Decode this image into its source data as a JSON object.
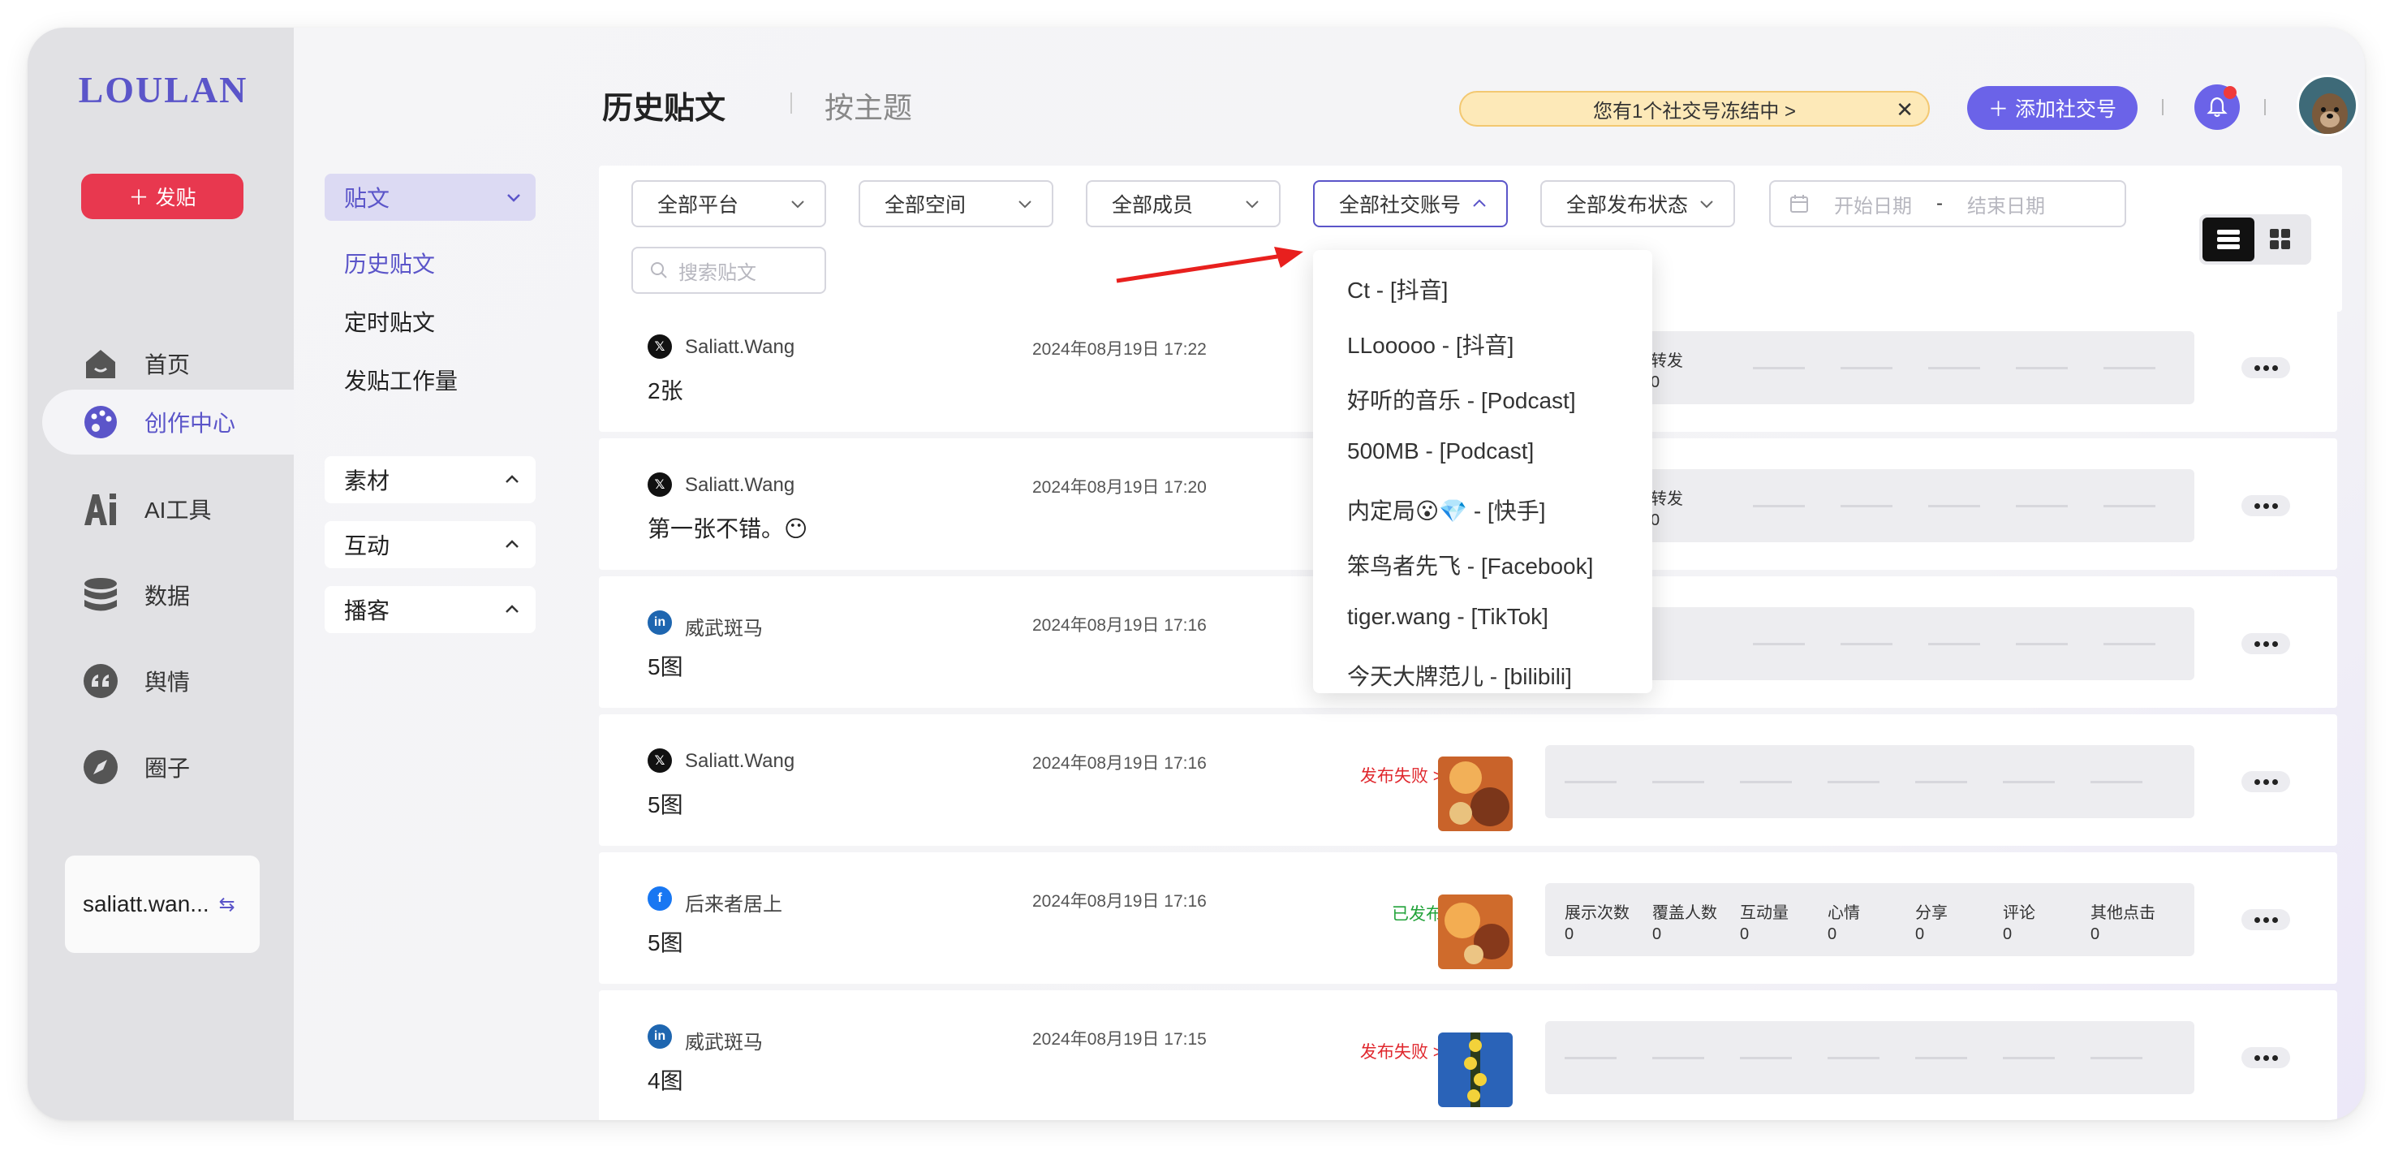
{
  "app": {
    "logo": "LOULAN"
  },
  "sidebar": {
    "post_button": "发贴",
    "items": [
      {
        "label": "首页",
        "icon": "home-icon"
      },
      {
        "label": "创作中心",
        "icon": "palette-icon",
        "active": true
      },
      {
        "label": "AI工具",
        "icon": "ai-icon"
      },
      {
        "label": "数据",
        "icon": "database-icon"
      },
      {
        "label": "舆情",
        "icon": "quote-icon"
      },
      {
        "label": "圈子",
        "icon": "compass-icon"
      }
    ],
    "user": {
      "name": "saliatt.wan...",
      "icon": "switch-account-icon"
    }
  },
  "subnav": {
    "header": "贴文",
    "links": [
      "历史贴文",
      "定时贴文",
      "发贴工作量"
    ],
    "groups": [
      "素材",
      "互动",
      "播客"
    ]
  },
  "header": {
    "title": "历史贴文",
    "tab2": "按主题",
    "notice": "您有1个社交号冻结中 >",
    "add_social": "添加社交号"
  },
  "filters": {
    "platform": "全部平台",
    "space": "全部空间",
    "member": "全部成员",
    "account": "全部社交账号",
    "status": "全部发布状态",
    "start_date": "开始日期",
    "date_sep": "-",
    "end_date": "结束日期",
    "search_placeholder": "搜索贴文"
  },
  "dropdown": {
    "options": [
      "Ct - [抖音]",
      "LLooooo - [抖音]",
      "好听的音乐 - [Podcast]",
      "500MB - [Podcast]",
      "内定局😮💎 - [快手]",
      "笨鸟者先飞 - [Facebook]",
      "tiger.wang - [TikTok]",
      "今天大牌范儿 - [bilibili]"
    ]
  },
  "stats_labels": [
    "展示次数",
    "覆盖人数",
    "互动量",
    "心情",
    "分享",
    "评论",
    "其他点击"
  ],
  "posts": [
    {
      "platform": "x",
      "author": "Saliatt.Wang",
      "content": "2张",
      "time": "2024年08月19日 17:22",
      "stat_label": "转发",
      "stat_value": "0"
    },
    {
      "platform": "x",
      "author": "Saliatt.Wang",
      "content": "第一张不错。😶",
      "time": "2024年08月19日 17:20",
      "stat_label": "转发",
      "stat_value": "0"
    },
    {
      "platform": "linkedin",
      "author": "威武斑马",
      "content": "5图",
      "time": "2024年08月19日 17:16"
    },
    {
      "platform": "x",
      "author": "Saliatt.Wang",
      "content": "5图",
      "time": "2024年08月19日 17:16",
      "status": "发布失败 >"
    },
    {
      "platform": "facebook",
      "author": "后来者居上",
      "content": "5图",
      "time": "2024年08月19日 17:16",
      "status": "已发布",
      "stats": [
        "0",
        "0",
        "0",
        "0",
        "0",
        "0",
        "0"
      ]
    },
    {
      "platform": "linkedin",
      "author": "威武斑马",
      "content": "4图",
      "time": "2024年08月19日 17:15",
      "status": "发布失败 >"
    }
  ],
  "colors": {
    "accent": "#5b55c9",
    "danger": "#e8384f",
    "success": "#22a33a",
    "fail": "#e0282e"
  }
}
